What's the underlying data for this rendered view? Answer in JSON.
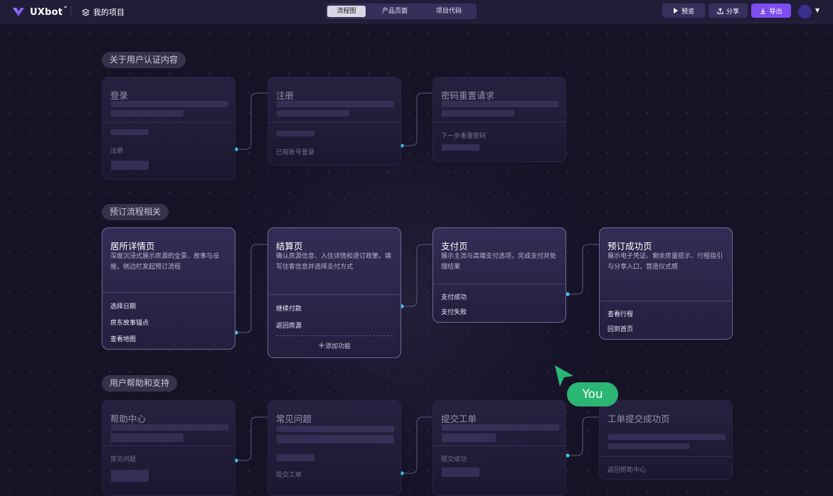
{
  "app": {
    "name": "UXbot",
    "star": "*",
    "project": "我的项目"
  },
  "view_tabs": [
    "流程图",
    "产品页面",
    "项目代码"
  ],
  "actions": {
    "preview": "预览",
    "share": "分享",
    "export": "导出"
  },
  "colors": {
    "accent": "#7d4df0",
    "connector": "#3ec6e8",
    "cursor": "#2bb673"
  },
  "groups": [
    {
      "label": "关于用户认证内容"
    },
    {
      "label": "预订流程相关"
    },
    {
      "label": "用户帮助和支持"
    }
  ],
  "cards": {
    "login": {
      "title": "登录",
      "items": [
        "注册"
      ]
    },
    "register": {
      "title": "注册",
      "items": [
        "已有账号登录"
      ]
    },
    "reset": {
      "title": "密码重置请求",
      "items": [
        "下一步重置密码"
      ]
    },
    "listing": {
      "title": "居所详情页",
      "desc": "深度沉浸式展示房源的全景、故事与设施，侧边栏发起预订流程",
      "items": [
        "选择日期",
        "房东故事锚点",
        "查看地图"
      ]
    },
    "checkout": {
      "title": "结算页",
      "desc": "确认房源信息、入住详情和退订政策，填写住客信息并选择支付方式",
      "items": [
        "继续付款",
        "返回房源"
      ],
      "add": "添加功能"
    },
    "payment": {
      "title": "支付页",
      "desc": "展示主流与高端支付选项，完成支付并处理结果",
      "items": [
        "支付成功",
        "支付失败"
      ]
    },
    "success": {
      "title": "预订成功页",
      "desc": "展示电子凭证、剩余房量提示、行程指引与分享入口，营造仪式感",
      "items": [
        "查看行程",
        "回到首页"
      ]
    },
    "help": {
      "title": "帮助中心",
      "items": [
        "常见问题"
      ]
    },
    "faq": {
      "title": "常见问题",
      "items": [
        "提交工单"
      ]
    },
    "ticket": {
      "title": "提交工单",
      "items": [
        "提交成功"
      ]
    },
    "ticket_ok": {
      "title": "工单提交成功页",
      "items": [
        "返回帮助中心"
      ]
    }
  },
  "cursor": {
    "label": "You"
  }
}
